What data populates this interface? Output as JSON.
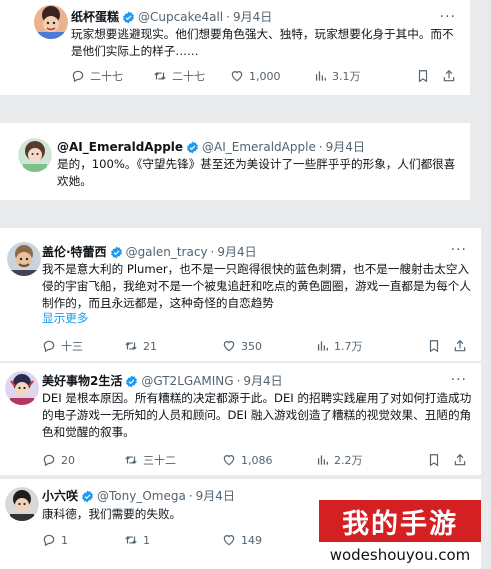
{
  "colors": {
    "accent": "#1d9bf0",
    "muted": "#536471",
    "text": "#0f1419",
    "watermark_red": "#d41f23"
  },
  "tweets": [
    {
      "name": "纸杯蛋糕",
      "handle": "@Cupcake4all",
      "dot": "·",
      "date": "9月4日",
      "body": "玩家想要逃避现实。他们想要角色强大、独特，玩家想要化身于其中。而不是他们实际上的样子……",
      "show_more": "",
      "replies": "二十七",
      "retweets": "二十七",
      "likes": "1,000",
      "views": "3.1万"
    },
    {
      "name": "@AI_EmeraldApple",
      "handle": "@AI_EmeraldApple",
      "dot": "·",
      "date": "9月4日",
      "body": "是的，100%。《守望先锋》甚至还为美设计了一些胖乎乎的形象，人们都很喜欢她。",
      "show_more": ""
    },
    {
      "name": "盖伦·特蕾西",
      "handle": "@galen_tracy",
      "dot": "·",
      "date": "9月4日",
      "body": "我不是意大利的 Plumer，也不是一只跑得很快的蓝色刺猬，也不是一艘射击太空入侵的宇宙飞船，我绝对不是一个被鬼追赶和吃点的黄色圆圈，游戏一直都是为每个人制作的，而且永远都是，这种奇怪的自恋趋势",
      "show_more": "显示更多",
      "replies": "十三",
      "retweets": "21",
      "likes": "350",
      "views": "1.7万"
    },
    {
      "name": "美好事物2生活",
      "handle": "@GT2LGAMING",
      "dot": "·",
      "date": "9月4日",
      "body": "DEI 是根本原因。所有糟糕的决定都源于此。DEI 的招聘实践雇用了对如何打造成功的电子游戏一无所知的人员和顾问。DEI 融入游戏创造了糟糕的视觉效果、丑陋的角色和觉醒的叙事。",
      "show_more": "",
      "replies": "20",
      "retweets": "三十二",
      "likes": "1,086",
      "views": "2.2万"
    },
    {
      "name": "小六咲",
      "handle": "@Tony_Omega",
      "dot": "·",
      "date": "9月4日",
      "body": "康科德，我们需要的失败。",
      "show_more": "",
      "replies": "1",
      "retweets": "1",
      "likes": "149"
    }
  ],
  "watermark": {
    "title": "我的手游",
    "url": "wodeshouyou.com"
  }
}
